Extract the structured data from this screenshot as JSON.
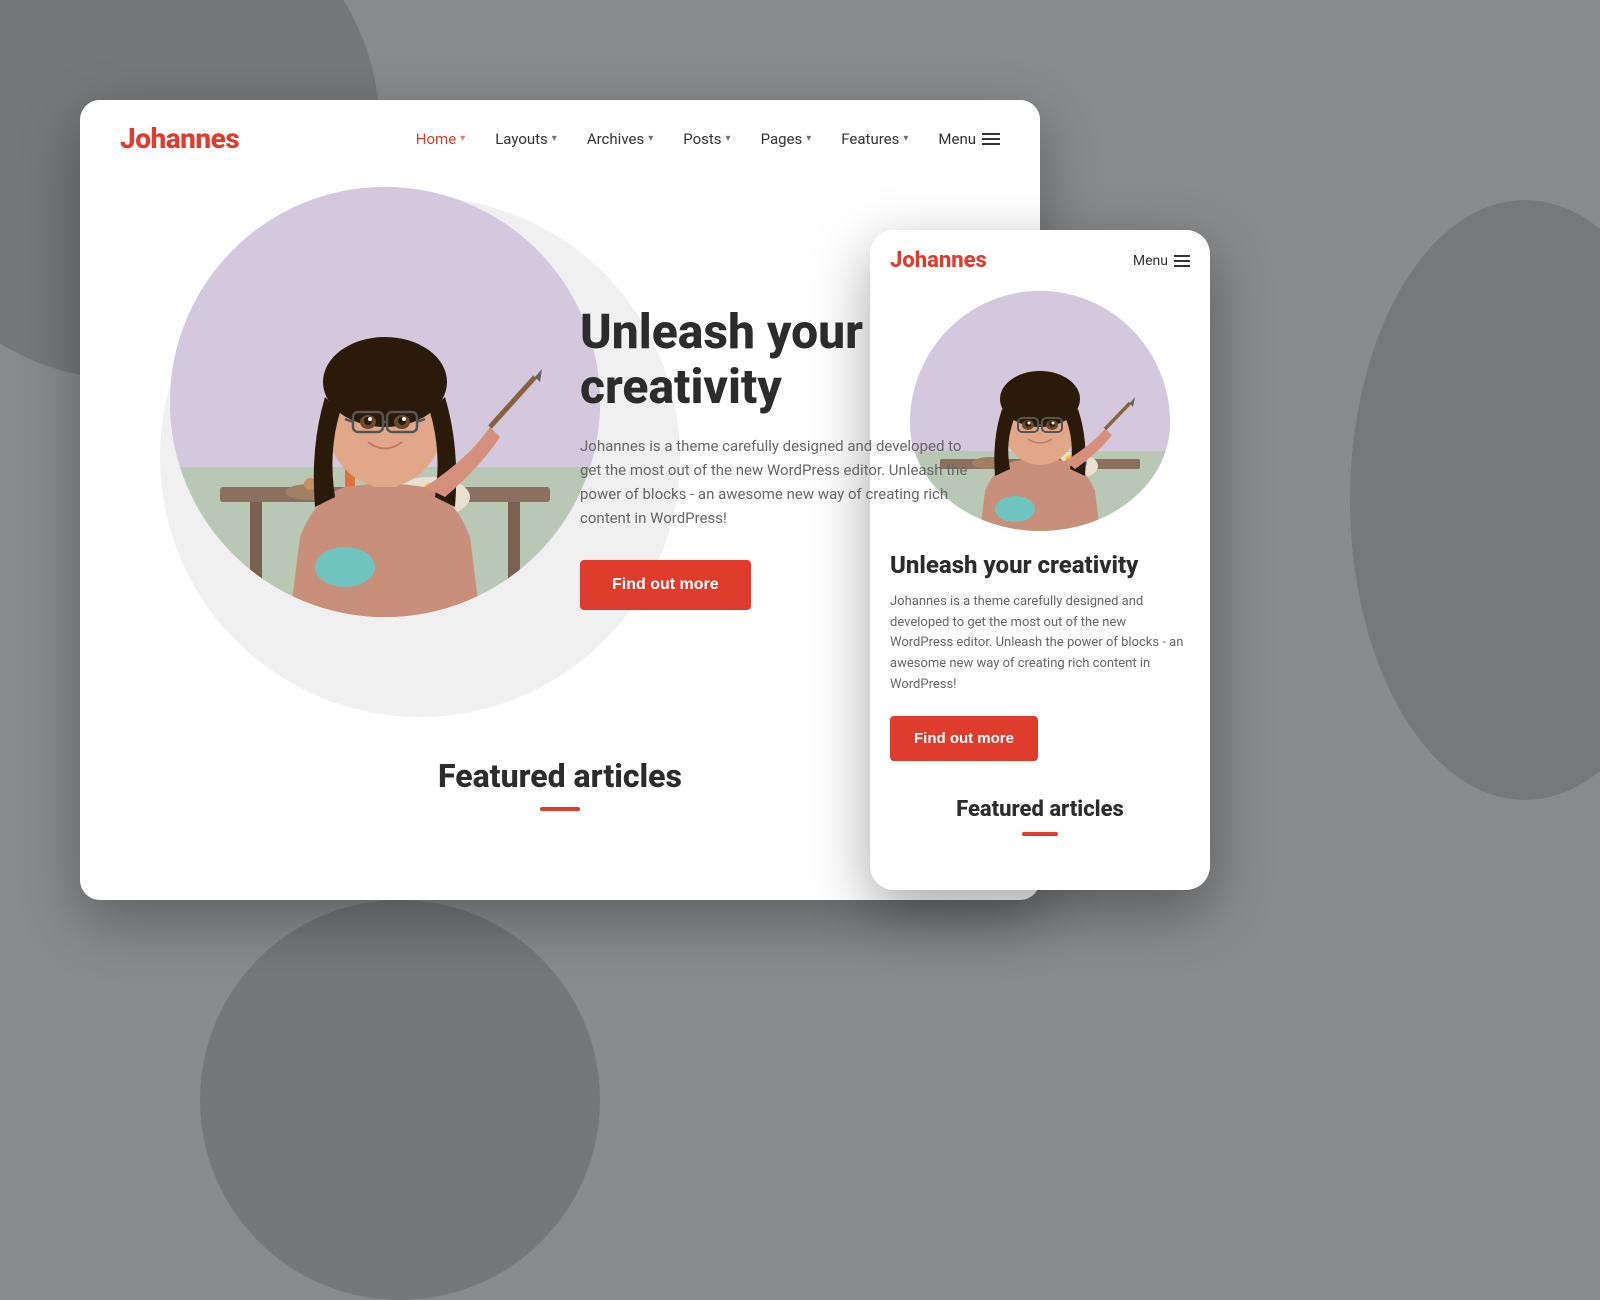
{
  "background": {
    "color": "#888a8c"
  },
  "desktop": {
    "brand": "Johannes",
    "nav": {
      "items": [
        {
          "label": "Home",
          "active": true,
          "hasDropdown": true
        },
        {
          "label": "Layouts",
          "active": false,
          "hasDropdown": true
        },
        {
          "label": "Archives",
          "active": false,
          "hasDropdown": true
        },
        {
          "label": "Posts",
          "active": false,
          "hasDropdown": true
        },
        {
          "label": "Pages",
          "active": false,
          "hasDropdown": true
        },
        {
          "label": "Features",
          "active": false,
          "hasDropdown": true
        }
      ],
      "menu_label": "Menu"
    },
    "hero": {
      "title": "Unleash your creativity",
      "description": "Johannes is a theme carefully designed and developed to get the most out of the new WordPress editor. Unleash the power of blocks - an awesome new way of creating rich content in WordPress!",
      "cta_label": "Find out more"
    },
    "featured": {
      "title": "Featured articles"
    }
  },
  "mobile": {
    "brand": "Johannes",
    "nav": {
      "menu_label": "Menu"
    },
    "hero": {
      "title": "Unleash your creativity",
      "description": "Johannes is a theme carefully designed and developed to get the most out of the new WordPress editor. Unleash the power of blocks - an awesome new way of creating rich content in WordPress!",
      "cta_label": "Find out more"
    },
    "featured": {
      "title": "Featured articles"
    }
  },
  "colors": {
    "brand_red": "#e03c2e",
    "text_dark": "#2c2c2c",
    "text_muted": "#666666",
    "bg_white": "#ffffff",
    "bg_blob": "#f0f0f0"
  }
}
